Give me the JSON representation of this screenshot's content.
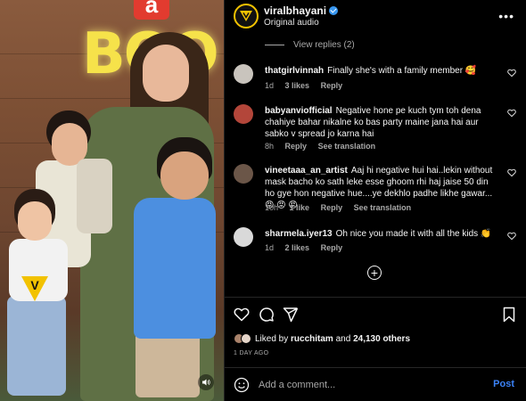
{
  "header": {
    "username": "viralbhayani",
    "subtitle": "Original audio",
    "more_label": "•••"
  },
  "media": {
    "sign_text": "BOO",
    "sign_top": "a",
    "watermark_letter": "V"
  },
  "view_replies": "View replies (2)",
  "comments": [
    {
      "username": "thatgirlvinnah",
      "text": "Finally she's with a family member 🥰",
      "time": "1d",
      "likes": "3 likes",
      "reply": "Reply",
      "translation": ""
    },
    {
      "username": "babyanviofficial",
      "text": "Negative hone pe kuch tym toh dena chahiye bahar nikalne ko bas party maine jana hai aur sabko v spread jo karna hai",
      "time": "8h",
      "likes": "",
      "reply": "Reply",
      "translation": "See translation"
    },
    {
      "username": "vineetaaa_an_artist",
      "text": "Aaj hi negative hui hai..lekin without mask bacho ko sath leke esse ghoom rhi haj jaise 50 din ho gye hon negative hue....ye dekhlo padhe likhe gawar... 😡 😡 😡",
      "time": "10h",
      "likes": "1 like",
      "reply": "Reply",
      "translation": "See translation"
    },
    {
      "username": "sharmela.iyer13",
      "text": "Oh nice you made it with all the kids 👏",
      "time": "1d",
      "likes": "2 likes",
      "reply": "Reply",
      "translation": ""
    }
  ],
  "likes": {
    "prefix": "Liked by",
    "user": "rucchitam",
    "conj": "and",
    "others": "24,130 others"
  },
  "time_ago": "1 DAY AGO",
  "add_comment": {
    "placeholder": "Add a comment...",
    "post_label": "Post"
  },
  "colors": {
    "accent_blue": "#3b82f6",
    "verified_blue": "#3897f0",
    "brand_yellow": "#f2c200",
    "muted": "#a8a8a8"
  }
}
